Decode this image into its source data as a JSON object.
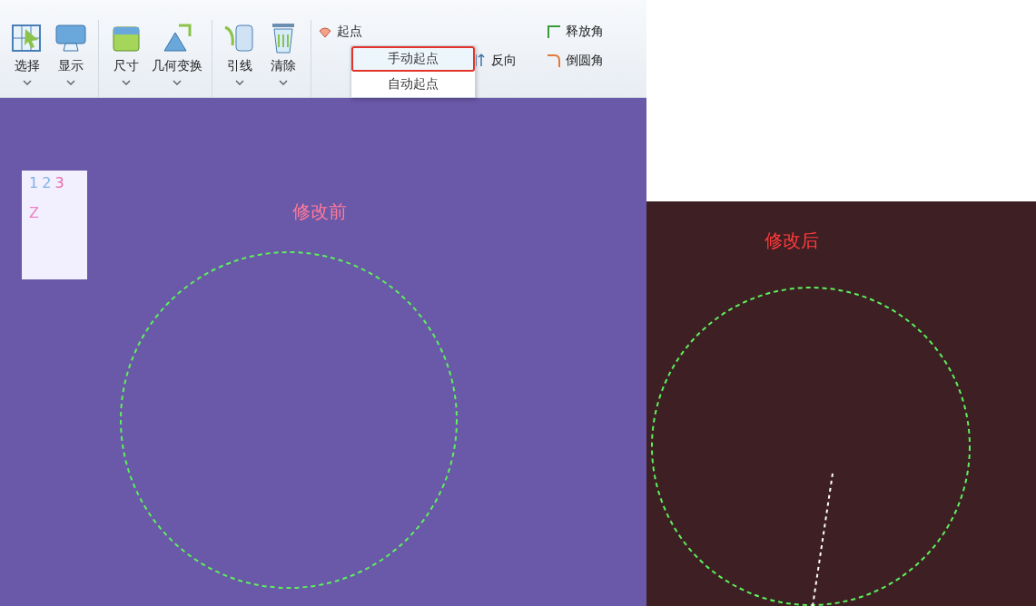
{
  "ribbon": {
    "large_buttons": [
      {
        "label": "选择"
      },
      {
        "label": "显示"
      },
      {
        "label": "尺寸"
      },
      {
        "label": "几何变换"
      },
      {
        "label": "引线"
      },
      {
        "label": "清除"
      }
    ],
    "small_buttons": [
      {
        "label": "起点"
      },
      {
        "label": "反向"
      },
      {
        "label": "释放角"
      },
      {
        "label": "倒圆角"
      }
    ],
    "dropdown": {
      "items": [
        {
          "label": "手动起点",
          "selected": true
        },
        {
          "label": "自动起点",
          "selected": false
        }
      ]
    }
  },
  "before_view": {
    "title": "修改前",
    "axis_labels": [
      "1",
      "2",
      "3",
      "Z"
    ]
  },
  "after_view": {
    "title": "修改后"
  }
}
